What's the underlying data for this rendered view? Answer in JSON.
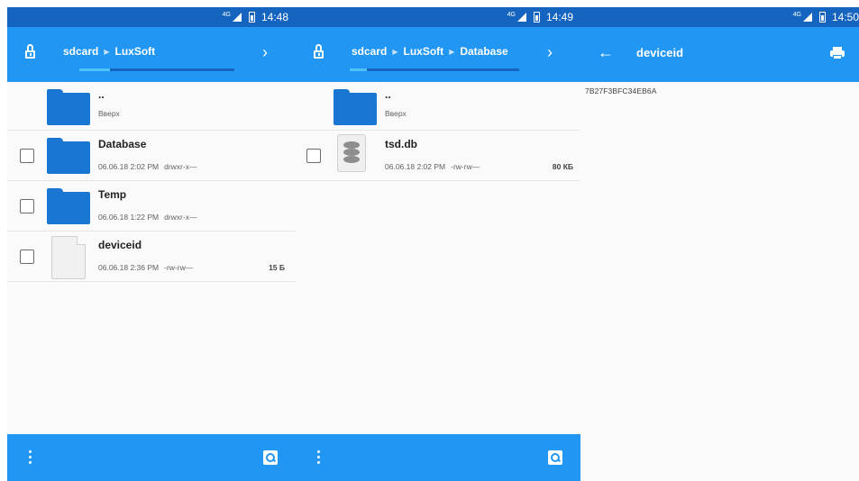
{
  "screens": [
    {
      "status_bar": {
        "network": "4G",
        "time": "14:48"
      },
      "breadcrumb": [
        "sdcard",
        "LuxSoft"
      ],
      "progress": 0.2,
      "rows": [
        {
          "name": "..",
          "date": "Вверх",
          "perms": "",
          "size": "",
          "kind": "up"
        },
        {
          "name": "Database",
          "date": "06.06.18 2:02 PM",
          "perms": "drwxr-x—",
          "size": "",
          "kind": "folder"
        },
        {
          "name": "Temp",
          "date": "06.06.18 1:22 PM",
          "perms": "drwxr-x—",
          "size": "",
          "kind": "folder"
        },
        {
          "name": "deviceid",
          "date": "06.06.18 2:36 PM",
          "perms": "-rw-rw—",
          "size": "15 Б",
          "kind": "file"
        }
      ]
    },
    {
      "status_bar": {
        "network": "4G",
        "time": "14:49"
      },
      "breadcrumb": [
        "sdcard",
        "LuxSoft",
        "Database"
      ],
      "progress": 0.1,
      "rows": [
        {
          "name": "..",
          "date": "Вверх",
          "perms": "",
          "size": "",
          "kind": "up"
        },
        {
          "name": "tsd.db",
          "date": "06.06.18 2:02 PM",
          "perms": "-rw-rw—",
          "size": "80 КБ",
          "kind": "database"
        }
      ]
    },
    {
      "status_bar": {
        "network": "4G",
        "time": "14:50"
      },
      "title": "deviceid",
      "content": "7B27F3BFC34EB6A"
    }
  ],
  "icons": {
    "lock": "lock-open-icon",
    "chevron": "chevron-right-icon",
    "more": "more-vert-icon",
    "search": "search-icon",
    "back": "arrow-back-icon",
    "print": "print-icon"
  },
  "colors": {
    "toolbar": "#2196f3",
    "status_bar": "#1565c0",
    "folder": "#1976d2",
    "progress": "#4fc3f7",
    "background": "#fafafa"
  }
}
